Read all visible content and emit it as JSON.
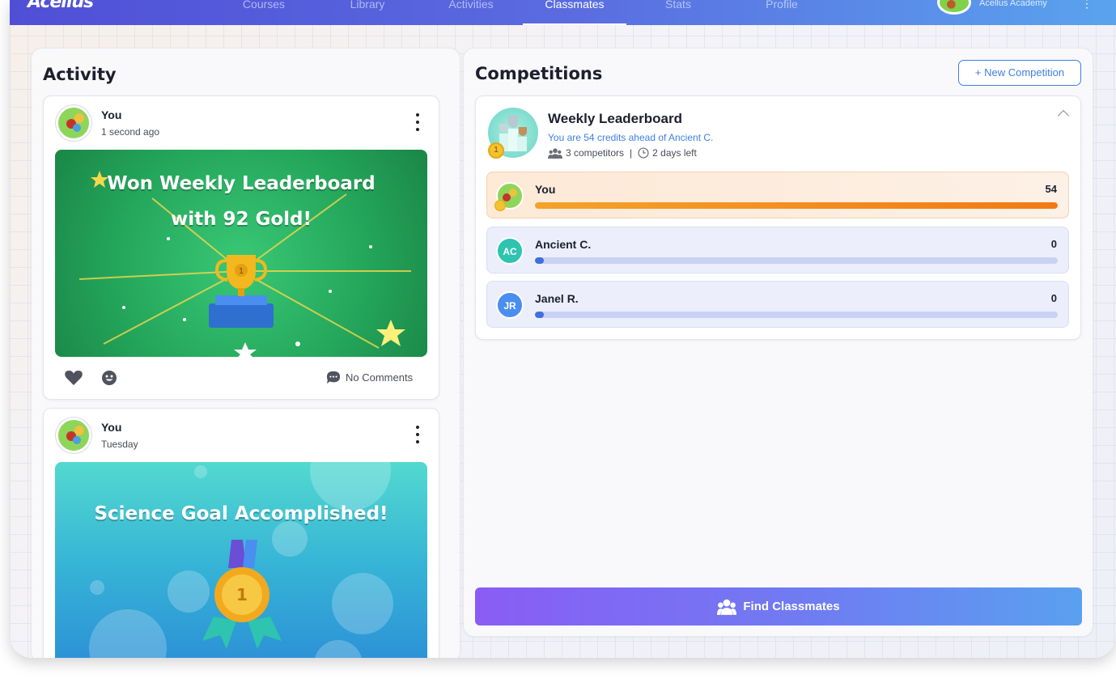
{
  "app": {
    "logo_text": "Acellus"
  },
  "nav": {
    "items": [
      {
        "label": "Courses",
        "active": false
      },
      {
        "label": "Library",
        "active": false
      },
      {
        "label": "Activities",
        "active": false
      },
      {
        "label": "Classmates",
        "active": true
      },
      {
        "label": "Stats",
        "active": false
      },
      {
        "label": "Profile",
        "active": false
      }
    ],
    "school": "Acellus Academy",
    "menu_icon": "kebab-menu-icon"
  },
  "activity": {
    "title": "Activity",
    "posts": [
      {
        "author": "You",
        "time": "1 second ago",
        "image_title_line1": "Won Weekly Leaderboard",
        "image_title_line2": "with 92 Gold!",
        "comments": "No Comments",
        "image_colors": [
          "#27b565",
          "#1e8a4c"
        ]
      },
      {
        "author": "You",
        "time": "Tuesday",
        "image_title_line1": "Science Goal Accomplished!",
        "image_colors": [
          "#4fd6d0",
          "#2b8fd6"
        ]
      }
    ]
  },
  "competitions": {
    "title": "Competitions",
    "new_button": "+ New Competition",
    "leaderboard": {
      "title": "Weekly Leaderboard",
      "subtitle": "You are 54 credits ahead of Ancient C.",
      "competitors": "3 competitors",
      "time_left": "2 days left",
      "medal_number": "1",
      "rows": [
        {
          "name": "You",
          "score": "54",
          "progress": 1.0,
          "initials": "",
          "color": "#f28c1a"
        },
        {
          "name": "Ancient C.",
          "score": "0",
          "progress": 0.0,
          "initials": "AC",
          "color": "#2ec4b0"
        },
        {
          "name": "Janel R.",
          "score": "0",
          "progress": 0.0,
          "initials": "JR",
          "color": "#4a8ef0"
        }
      ]
    },
    "find_button": "Find Classmates"
  },
  "colors": {
    "accent": "#3f7fe0",
    "brand_purple": "#8a5cf5",
    "orange": "#f28c1a"
  }
}
